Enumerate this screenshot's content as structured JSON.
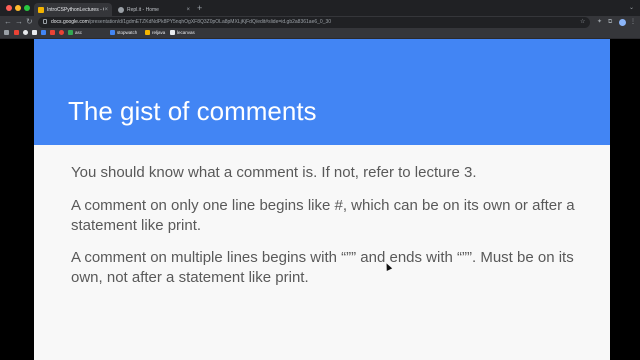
{
  "browser": {
    "tabs": [
      {
        "label": "IntroCSPythonLectures - Goo",
        "active": true,
        "favicon_color": "#f4b400"
      },
      {
        "label": "Repl.it - Home",
        "active": false,
        "favicon_color": "#9aa0a6"
      }
    ],
    "new_tab_label": "+",
    "url_host": "docs.google.com",
    "url_path": "/presentation/d/1gdmETZKdNdPk8PY5nqhOgXF8Q3Z0pOLa8pMXLjKjFdQ/edit#slide=id.gb2a8361ae6_0_30",
    "bookmarks": [
      {
        "label": "",
        "icon_color": "#ea4335"
      },
      {
        "label": "",
        "icon_color": "#e8eaed"
      },
      {
        "label": "",
        "icon_color": "#e8eaed"
      },
      {
        "label": "",
        "icon_color": "#4285f4"
      },
      {
        "label": "",
        "icon_color": "#ea4335"
      },
      {
        "label": "",
        "icon_color": "#ea4335"
      },
      {
        "label": "asc",
        "icon_color": "#34a853"
      },
      {
        "label": "stopwatch",
        "icon_color": "#4285f4"
      },
      {
        "label": "reljava",
        "icon_color": "#f4b400"
      },
      {
        "label": "lecanvas",
        "icon_color": "#e8eaed"
      }
    ]
  },
  "slide": {
    "title": "The gist of comments",
    "header_color": "#4285f4",
    "paragraphs": [
      "You should know what a comment is. If not, refer to lecture 3.",
      "A comment on only one line begins like #, which can be on its own or after a statement like print.",
      "A comment on multiple lines begins with “”” and ends with “””. Must be on its own, not after a statement like print."
    ]
  }
}
